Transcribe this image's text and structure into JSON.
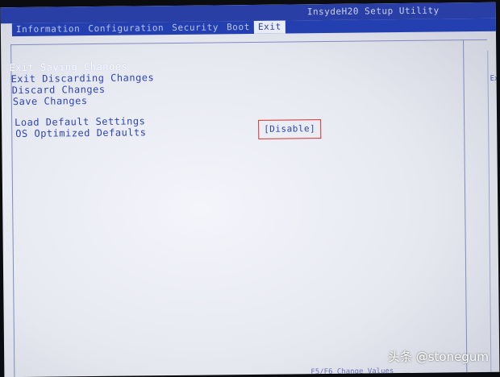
{
  "app": {
    "title": "InsydeH20 Setup Utility"
  },
  "tabs": [
    {
      "label": "Information"
    },
    {
      "label": "Configuration"
    },
    {
      "label": "Security"
    },
    {
      "label": "Boot"
    },
    {
      "label": "Exit",
      "active": true
    }
  ],
  "menu": {
    "items": [
      {
        "label": "Exit Saving Changes"
      },
      {
        "label": "Exit Discarding Changes"
      },
      {
        "label": "Discard Changes"
      },
      {
        "label": "Save Changes"
      },
      {
        "label": "Load Default Settings"
      },
      {
        "label": "OS Optimized Defaults"
      }
    ],
    "os_optimized_value": "[Disable]"
  },
  "right_panel": {
    "hint": "Ex"
  },
  "footer": {
    "hint": "F5/F6 Change Values"
  },
  "watermark": {
    "text": "头条 @stonegum"
  },
  "colors": {
    "tab_bar": "#2440b0",
    "text": "#2d45b5",
    "highlight_box": "#d03030"
  }
}
